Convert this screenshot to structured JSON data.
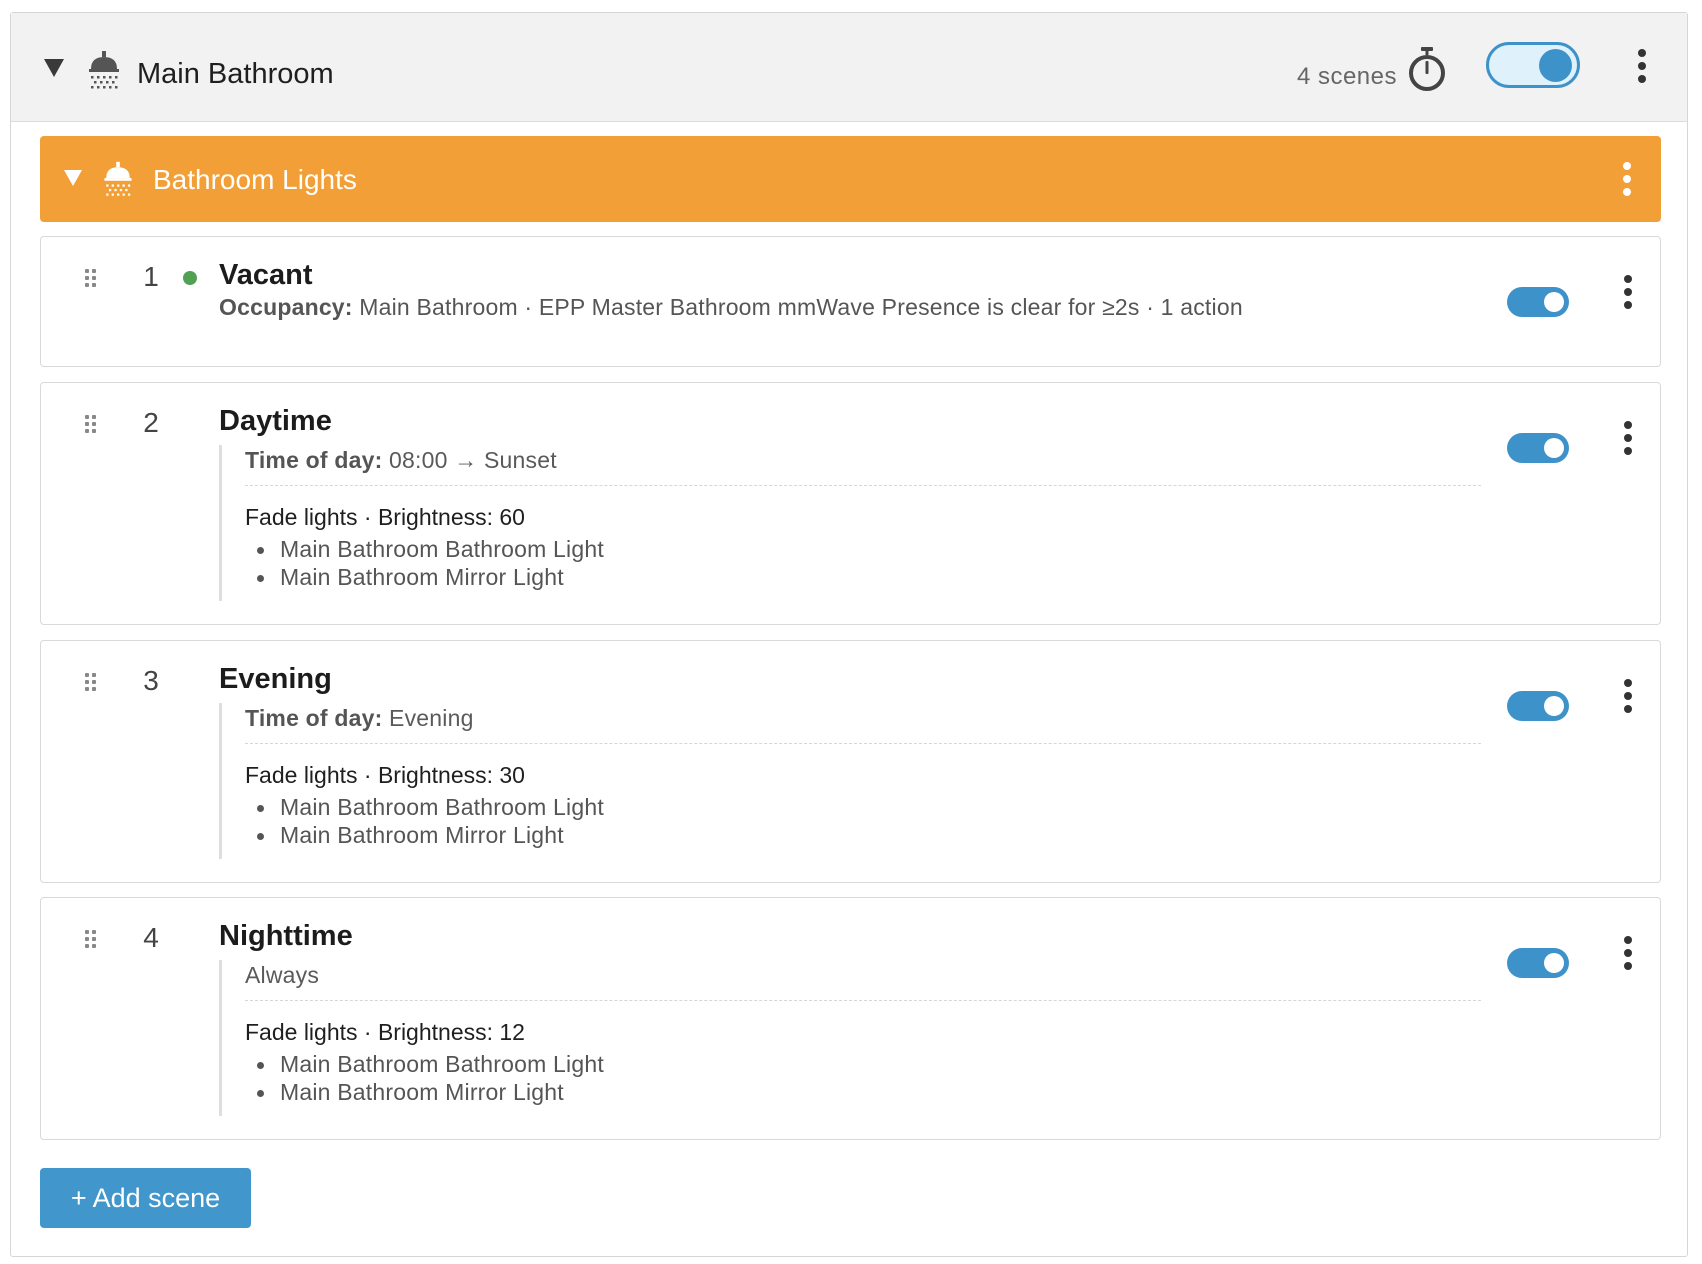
{
  "room": {
    "title": "Main Bathroom",
    "scene_count": "4 scenes",
    "enabled": true,
    "icon": "shower-icon"
  },
  "group": {
    "title": "Bathroom Lights",
    "color": "#f19f36",
    "icon": "shower-icon"
  },
  "scenes": [
    {
      "number": "1",
      "name": "Vacant",
      "active": true,
      "occupancy_label": "Occupancy:",
      "occupancy_text": " Main Bathroom · EPP Master Bathroom mmWave Presence is clear for ≥2s · 1 action",
      "enabled": true
    },
    {
      "number": "2",
      "name": "Daytime",
      "condition_label": "Time of day:",
      "condition_text": " 08:00 → Sunset",
      "action": "Fade lights · Brightness: 60",
      "targets": [
        "Main Bathroom Bathroom Light",
        "Main Bathroom Mirror Light"
      ],
      "enabled": true
    },
    {
      "number": "3",
      "name": "Evening",
      "condition_label": "Time of day:",
      "condition_text": " Evening",
      "action": "Fade lights · Brightness: 30",
      "targets": [
        "Main Bathroom Bathroom Light",
        "Main Bathroom Mirror Light"
      ],
      "enabled": true
    },
    {
      "number": "4",
      "name": "Nighttime",
      "condition_text": "Always",
      "action": "Fade lights · Brightness: 12",
      "targets": [
        "Main Bathroom Bathroom Light",
        "Main Bathroom Mirror Light"
      ],
      "enabled": true
    }
  ],
  "add_scene_label": "+ Add scene",
  "colors": {
    "accent": "#3d92c9",
    "active_dot": "#51a154"
  }
}
